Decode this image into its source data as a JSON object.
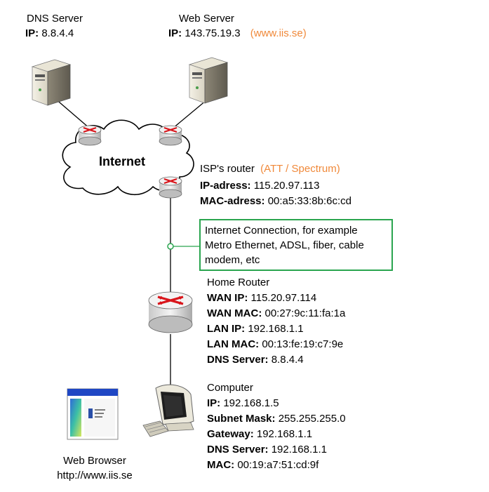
{
  "dns_server": {
    "title": "DNS Server",
    "ip_label": "IP:",
    "ip_value": "8.8.4.4"
  },
  "web_server": {
    "title": "Web Server",
    "ip_label": "IP:",
    "ip_value": "143.75.19.3",
    "host": "(www.iis.se)"
  },
  "cloud": {
    "label": "Internet"
  },
  "isp_router": {
    "title": "ISP's router",
    "provider": "(ATT / Spectrum)",
    "ip_label": "IP-adress:",
    "ip_value": "115.20.97.113",
    "mac_label": "MAC-adress:",
    "mac_value": "00:a5:33:8b:6c:cd"
  },
  "connection_note": {
    "text": "Internet Connection, for example Metro Ethernet, ADSL, fiber, cable modem, etc"
  },
  "home_router": {
    "title": "Home Router",
    "wan_ip_label": "WAN IP:",
    "wan_ip_value": "115.20.97.114",
    "wan_mac_label": "WAN MAC:",
    "wan_mac_value": "00:27:9c:11:fa:1a",
    "lan_ip_label": "LAN IP:",
    "lan_ip_value": "192.168.1.1",
    "lan_mac_label": "LAN MAC:",
    "lan_mac_value": "00:13:fe:19:c7:9e",
    "dns_label": "DNS Server:",
    "dns_value": "8.8.4.4"
  },
  "computer": {
    "title": "Computer",
    "ip_label": "IP:",
    "ip_value": "192.168.1.5",
    "mask_label": "Subnet Mask:",
    "mask_value": "255.255.255.0",
    "gw_label": "Gateway:",
    "gw_value": "192.168.1.1",
    "dns_label": "DNS Server:",
    "dns_value": "192.168.1.1",
    "mac_label": "MAC:",
    "mac_value": "00:19:a7:51:cd:9f"
  },
  "web_browser": {
    "title": "Web Browser",
    "url": "http://www.iis.se"
  },
  "colors": {
    "accent_orange": "#f0893a",
    "callout_green": "#2aa54f",
    "router_red": "#d9151b",
    "browser_blue": "#1f47c4"
  }
}
